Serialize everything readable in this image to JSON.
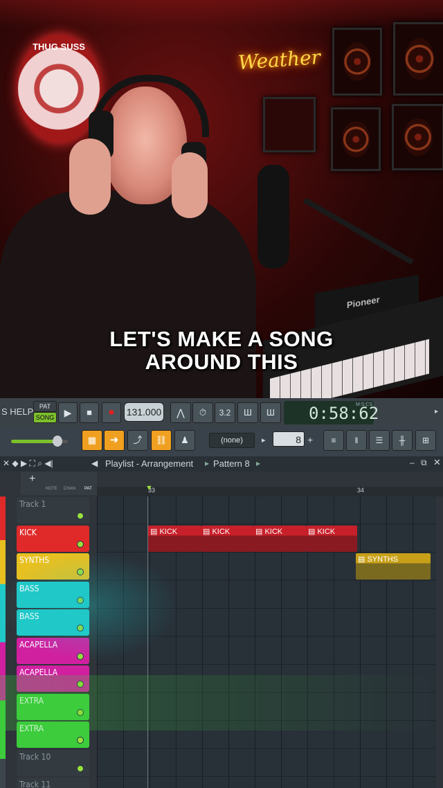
{
  "video": {
    "caption_line1": "LET'S MAKE A SONG",
    "caption_line2": "AROUND THIS",
    "neon_sign": "Weather",
    "logo_text": "THUG SUSS",
    "device_brand": "Pioneer"
  },
  "toolbar": {
    "help_label": "S HELP",
    "pat_label": "PAT",
    "song_label": "SONG",
    "tempo": "131.000",
    "time_display": "0:58:62",
    "time_unit": "M:S:CS",
    "pattern_select": "(none)",
    "step_value": "8"
  },
  "playlist": {
    "title": "Playlist - Arrangement",
    "pattern": "Pattern 8",
    "tabs": [
      "NOTE",
      "CHAN",
      "PAT"
    ],
    "bar_markers": [
      "33",
      "34"
    ],
    "tracks": [
      {
        "label": "Track 1",
        "color": "#3c454c"
      },
      {
        "label": "KICK",
        "color": "#e02a2a"
      },
      {
        "label": "SYNTHS",
        "color": "#e8c020"
      },
      {
        "label": "BASS",
        "color": "#20c8c8"
      },
      {
        "label": "BASS",
        "color": "#20c8c8"
      },
      {
        "label": "ACAPELLA",
        "color": "#d020a0"
      },
      {
        "label": "ACAPELLA",
        "color": "#d020a0"
      },
      {
        "label": "EXTRA",
        "color": "#3ccc3c"
      },
      {
        "label": "EXTRA",
        "color": "#3ccc3c"
      },
      {
        "label": "Track 10",
        "color": "#3c454c"
      },
      {
        "label": "Track 11",
        "color": "#3c454c"
      }
    ],
    "clips": [
      {
        "label": "KICK",
        "color": "#c8202a"
      },
      {
        "label": "KICK",
        "color": "#c8202a"
      },
      {
        "label": "KICK",
        "color": "#c8202a"
      },
      {
        "label": "KICK",
        "color": "#c8202a"
      },
      {
        "label": "SYNTHS",
        "color": "#c8a018"
      }
    ]
  }
}
